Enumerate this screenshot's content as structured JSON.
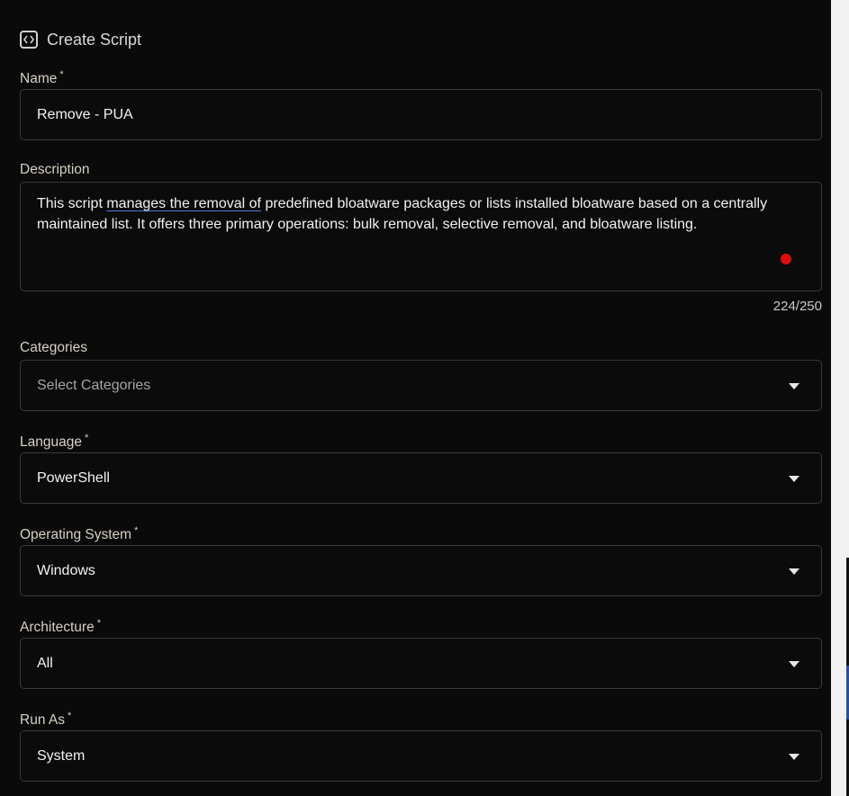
{
  "header": {
    "title": "Create Script",
    "icon": "code-brackets-icon"
  },
  "form": {
    "name": {
      "label": "Name",
      "required_mark": "*",
      "value": "Remove - PUA"
    },
    "description": {
      "label": "Description",
      "value_part1": "This script ",
      "value_spell1": "manages the removal of",
      "value_part2": " predefined bloatware packages or lists installed bloatware based on a centrally maintained list. It offers three primary operations: bulk removal, selective removal, and bloatware listing.",
      "counter": "224/250"
    },
    "categories": {
      "label": "Categories",
      "placeholder": "Select Categories"
    },
    "language": {
      "label": "Language",
      "required_mark": "*",
      "value": "PowerShell"
    },
    "operating_system": {
      "label": "Operating System",
      "required_mark": "*",
      "value": "Windows"
    },
    "architecture": {
      "label": "Architecture",
      "required_mark": "*",
      "value": "All"
    },
    "run_as": {
      "label": "Run As",
      "required_mark": "*",
      "value": "System"
    }
  },
  "colors": {
    "panel_bg": "#0a0a0b",
    "border": "#3a3a3e",
    "label": "#d6d0c4",
    "recording_dot": "#d90e0e",
    "spellcheck_underline": "#4a7bd8"
  }
}
